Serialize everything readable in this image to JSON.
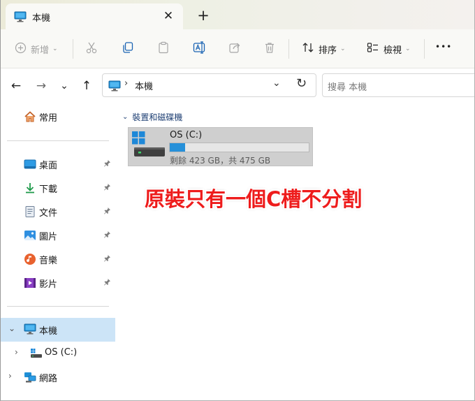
{
  "tab": {
    "title": "本機",
    "close_glyph": "✕",
    "new_tab_glyph": "+"
  },
  "toolbar": {
    "new_label": "新增",
    "sort_label": "排序",
    "view_label": "檢視",
    "more_glyph": "•••",
    "caret": "⌄"
  },
  "nav": {
    "back": "←",
    "forward": "→",
    "recent": "⌄",
    "up": "↑",
    "breadcrumb": [
      "本機"
    ],
    "breadcrumb_sep": "›",
    "dropdown": "⌄",
    "refresh": "↻",
    "search_placeholder": "搜尋 本機"
  },
  "sidebar": {
    "home": "常用",
    "quick_access": [
      {
        "label": "桌面",
        "icon": "desktop-icon"
      },
      {
        "label": "下載",
        "icon": "download-icon"
      },
      {
        "label": "文件",
        "icon": "documents-icon"
      },
      {
        "label": "圖片",
        "icon": "pictures-icon"
      },
      {
        "label": "音樂",
        "icon": "music-icon"
      },
      {
        "label": "影片",
        "icon": "videos-icon"
      }
    ],
    "this_pc": "本機",
    "os_drive": "OS (C:)",
    "network": "網路",
    "pin_glyph": "📌"
  },
  "content": {
    "group_title": "裝置和磁碟機",
    "drive": {
      "name": "OS (C:)",
      "free_text": "剩餘 423 GB，共 475 GB",
      "used_fraction": 0.11
    },
    "annotation": "原裝只有一個C槽不分割"
  },
  "colors": {
    "selection": "#cce4f7",
    "drive_bar": "#2690d9",
    "annotation": "#ee1c1c",
    "group_title": "#1e3f73"
  }
}
